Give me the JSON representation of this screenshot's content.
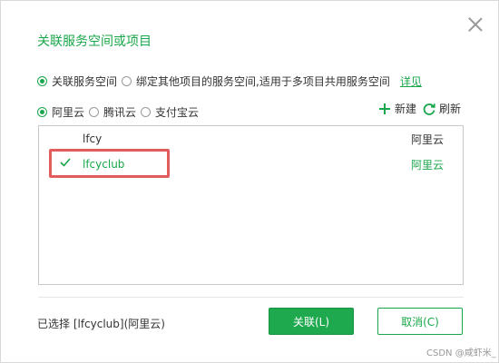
{
  "dialog": {
    "title": "关联服务空间或项目",
    "scope_options": [
      {
        "label": "关联服务空间",
        "checked": true
      },
      {
        "label": "绑定其他项目的服务空间,适用于多项目共用服务空间",
        "checked": false
      }
    ],
    "scope_link": "详见",
    "providers": [
      {
        "label": "阿里云",
        "checked": true
      },
      {
        "label": "腾讯云",
        "checked": false
      },
      {
        "label": "支付宝云",
        "checked": false
      }
    ],
    "tools": {
      "new_label": "新建",
      "refresh_label": "刷新"
    },
    "spaces": [
      {
        "name": "lfcy",
        "provider": "阿里云",
        "selected": false
      },
      {
        "name": "lfcyclub",
        "provider": "阿里云",
        "selected": true
      }
    ],
    "selection_text": "已选择 [lfcyclub](阿里云)",
    "ok_label": "关联(L)",
    "cancel_label": "取消(C)"
  },
  "watermark": "CSDN @咸虾米_",
  "colors": {
    "accent": "#1aa64a",
    "highlight": "#e35c5c"
  }
}
